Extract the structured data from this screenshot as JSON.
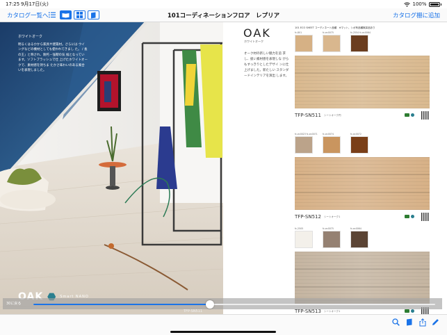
{
  "status": {
    "time": "17:25",
    "date": "9月17日(火)",
    "battery": "100%"
  },
  "nav": {
    "back_label": "カタログ一覧へ",
    "title": "101コーディネーションフロア　レプリア",
    "right_label": "カタログ棚に追加",
    "tools": [
      "list-view-icon",
      "single-page-icon",
      "grid-view-icon",
      "bookmark-icon"
    ],
    "active_tool": "single-page-icon"
  },
  "photo_page": {
    "intro_heading": "ホワイトオーク",
    "intro_text": "明るくはるかから家具や建築材。さらには ウイングなどの機材としても使われてきまし た。 / 長の王」と称され、耐朽・強靭の気 候となっています。ソフトブラッシュで仕 上げたホワイトオークで、素材感を持ちま たかさ味わいのある風合いを表現しました。",
    "brand_name": "OAK",
    "brand_sub": "Smart NANO"
  },
  "catalog_page": {
    "title": "OAK",
    "subtitle": "ホワイトオーク",
    "description": "オーク材の新しい魅力を追 求し、扱い素材感を表現しな がらもすっきりとしたデザイ ンに仕上げました。新たしい スタンダードインテリアを演出 します。",
    "products": [
      {
        "series_label": "101 ECO SHEET コーディネート品種　※マット、シボ有品種無採品あり",
        "swatches": [
          {
            "code": "fc-801",
            "color": "#d6b185"
          },
          {
            "code": "fc-ec0075",
            "color": "#d9b78e"
          },
          {
            "code": "fc-2554 fc-ec0064",
            "color": "#6b3d1f"
          }
        ],
        "plank_color": "#d9b98f",
        "sku": "TFP-SN511",
        "note": "シートオーク円"
      },
      {
        "series_label": "",
        "swatches": [
          {
            "code": "fc-ec0023 fc-ec0071",
            "color": "#bba38a"
          },
          {
            "code": "fc-ec0074",
            "color": "#c9955f"
          },
          {
            "code": "fc-ec0072",
            "color": "#7a3f18"
          }
        ],
        "plank_color": "#d7b187",
        "sku": "TFP-SN512",
        "note": "シートオーク1"
      },
      {
        "series_label": "",
        "swatches": [
          {
            "code": "fc-2505",
            "color": "#f3f0ea"
          },
          {
            "code": "fc-ec0075",
            "color": "#958172"
          },
          {
            "code": "fc-ec0064",
            "color": "#5b4434"
          }
        ],
        "plank_color": "#c5b5a1",
        "sku": "TFP-SN513",
        "note": "シートオーク1"
      }
    ]
  },
  "slider": {
    "label": "30に戻る",
    "progress": 0.44,
    "page_label": "TFP-SN511"
  },
  "bottom_tools": [
    "search-icon",
    "bookmark-icon",
    "share-icon",
    "pen-icon"
  ],
  "colors": {
    "accent": "#1a73e8",
    "sky": "#2a5d8f",
    "wall": "#f3f2ef",
    "floor": "#ded6ca"
  }
}
